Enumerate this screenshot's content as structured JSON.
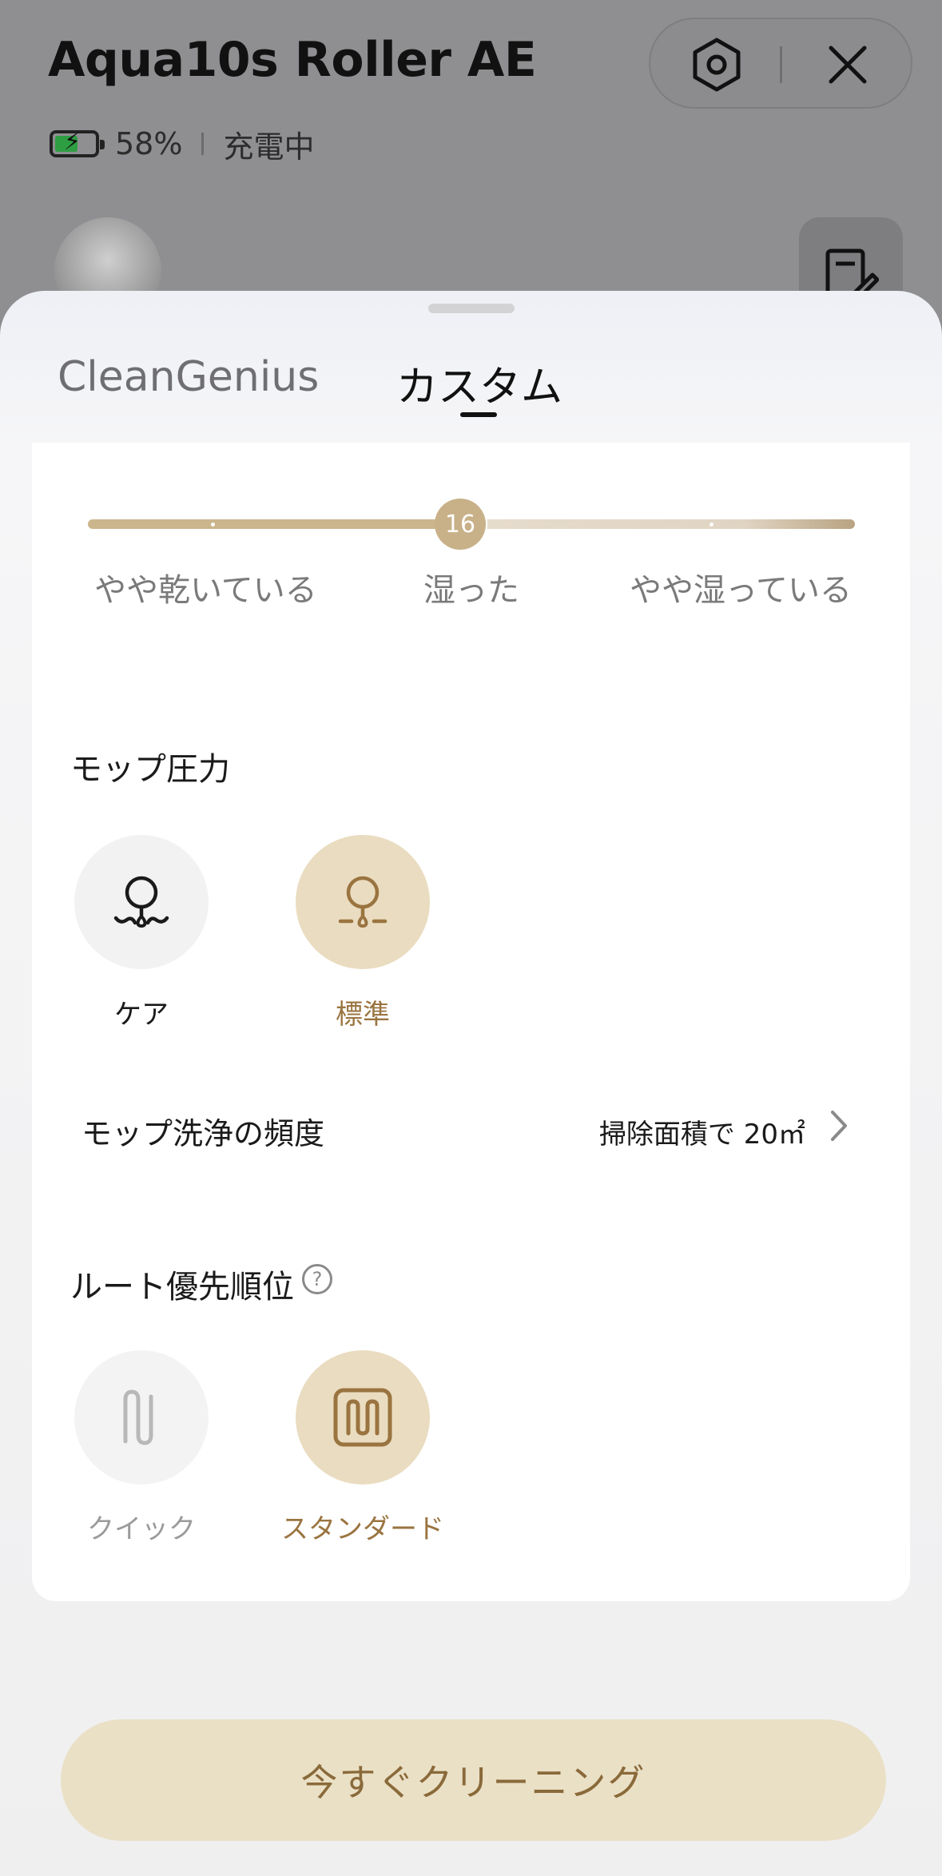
{
  "header": {
    "device_name": "Aqua10s Roller AE",
    "battery_percent": "58%",
    "battery_level": 0.58,
    "charging_status": "充電中"
  },
  "tabs": [
    {
      "label": "CleanGenius",
      "active": false
    },
    {
      "label": "カスタム",
      "active": true
    }
  ],
  "moisture": {
    "value": "16",
    "labels": [
      "やや乾いている",
      "湿った",
      "やや湿っている"
    ]
  },
  "mop_pressure": {
    "title": "モップ圧力",
    "options": [
      {
        "label": "ケア",
        "selected": false
      },
      {
        "label": "標準",
        "selected": true
      }
    ]
  },
  "mop_wash": {
    "label": "モップ洗浄の頻度",
    "value": "掃除面積で 20㎡"
  },
  "route_priority": {
    "title": "ルート優先順位",
    "help": "?",
    "options": [
      {
        "label": "クイック",
        "selected": false
      },
      {
        "label": "スタンダード",
        "selected": true
      }
    ]
  },
  "cta": {
    "label": "今すぐクリーニング"
  },
  "colors": {
    "accent": "#c8b188",
    "accent_text": "#9a7440",
    "cta_bg": "#eae0c6",
    "battery_green": "#2e9e42"
  }
}
